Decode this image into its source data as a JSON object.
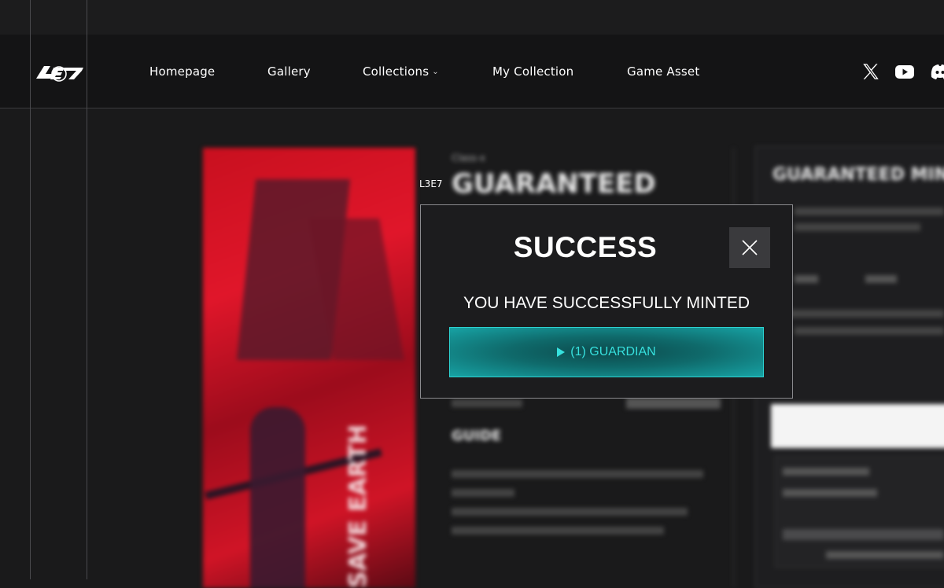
{
  "nav": {
    "links": [
      "Homepage",
      "Gallery",
      "Collections",
      "My Collection",
      "Game Asset"
    ],
    "social": [
      "x-icon",
      "youtube-icon",
      "discord-icon"
    ]
  },
  "logo": {
    "text": "L3E7"
  },
  "background": {
    "poster_text": "SAVE EARTH",
    "mid_kicker": "Class-x",
    "mid_title": "GUARANTEED",
    "guide_heading": "GUIDE",
    "right_title": "GUARANTEED MINT"
  },
  "modal": {
    "label": "L3E7",
    "title": "SUCCESS",
    "message": "YOU HAVE SUCCESSFULLY MINTED",
    "button_label": "(1) GUARDIAN"
  },
  "colors": {
    "accent": "#2dd1d0",
    "accent_text": "#36e1de",
    "background": "#1a1a1b",
    "poster_red": "#e0162a"
  }
}
